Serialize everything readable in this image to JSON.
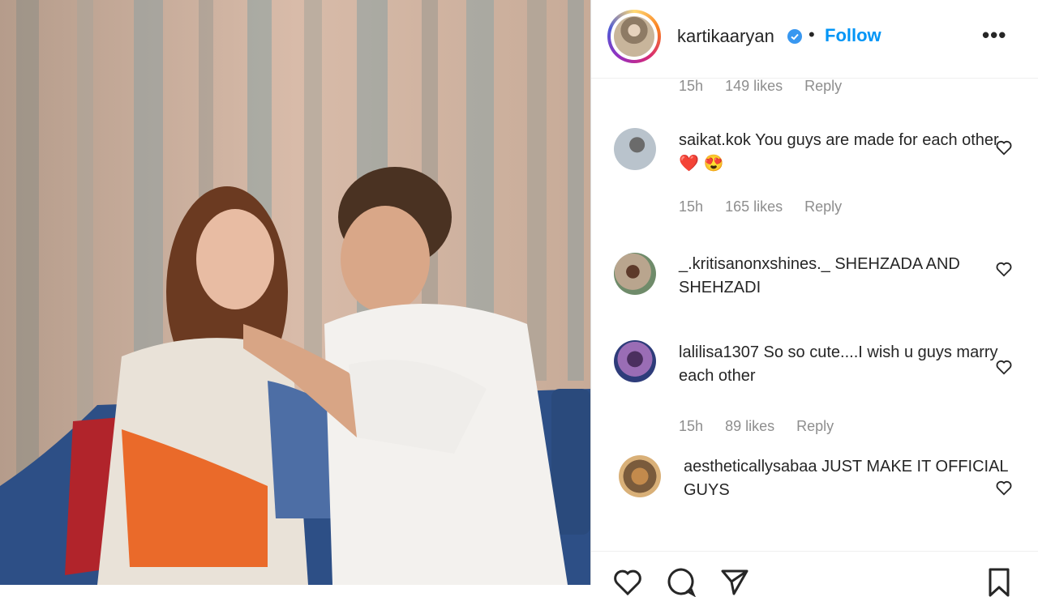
{
  "post": {
    "username": "kartikaaryan",
    "follow_label": "Follow",
    "separator": "•",
    "more_label": "•••"
  },
  "comments": [
    {
      "username": "",
      "text": "",
      "time": "15h",
      "likes": "149 likes",
      "reply": "Reply"
    },
    {
      "username": "saikat.kok",
      "text": "You guys are made for each other ❤️ 😍",
      "time": "15h",
      "likes": "165 likes",
      "reply": "Reply"
    },
    {
      "username": "_.kritisanonxshines._",
      "text": "SHEHZADA AND SHEHZADI",
      "time": "",
      "likes": "",
      "reply": ""
    },
    {
      "username": "lalilisa1307",
      "text": "So so cute....I wish u guys marry each other",
      "time": "15h",
      "likes": "89 likes",
      "reply": "Reply"
    },
    {
      "username": "aestheticallysabaa",
      "text": "JUST MAKE IT OFFICIAL GUYS",
      "time": "",
      "likes": "",
      "reply": ""
    }
  ],
  "colors": {
    "accent": "#0095f6",
    "verified": "#3897f0",
    "text": "#262626",
    "muted": "#8e8e8e"
  }
}
